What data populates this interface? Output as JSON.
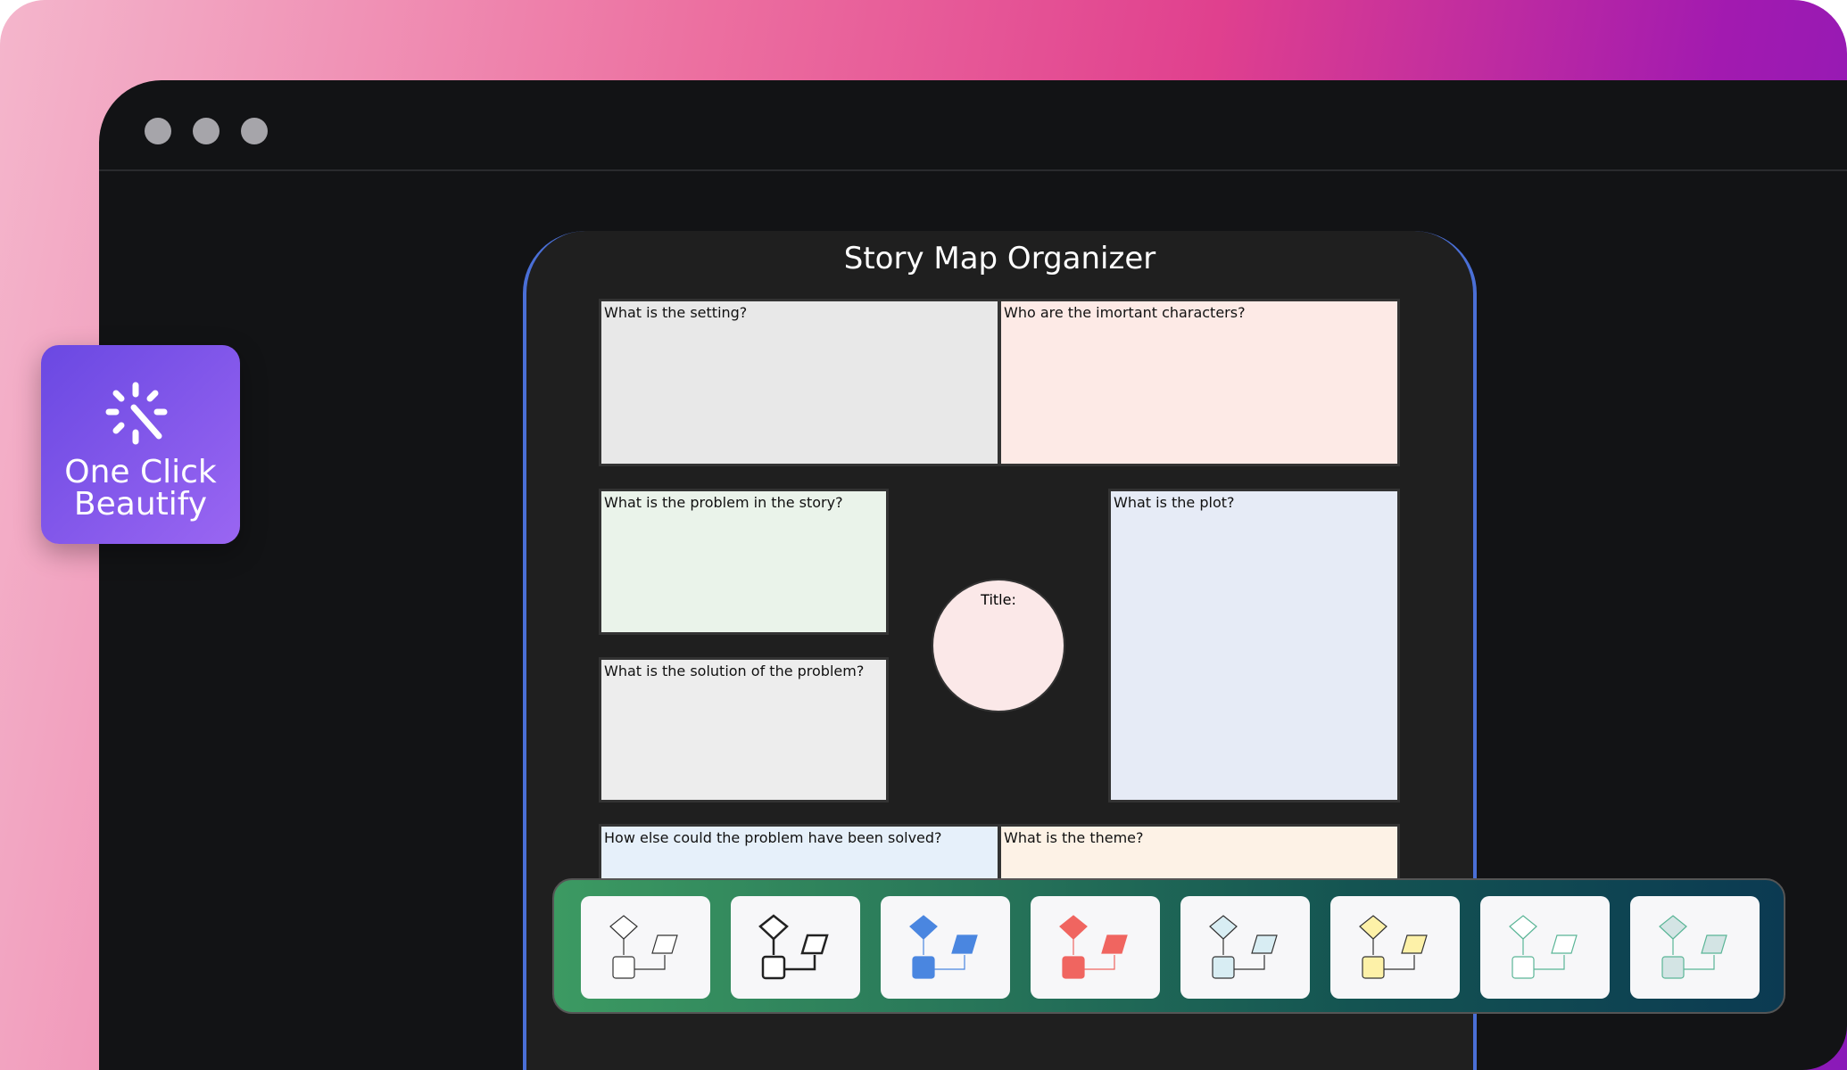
{
  "badge": {
    "label_line1": "One Click",
    "label_line2": "Beautify",
    "icon": "magic-wand-sparkle-icon"
  },
  "diagram": {
    "title": "Story Map Organizer",
    "boxes": [
      {
        "label": "What is the setting?",
        "color": "#e8e8e8"
      },
      {
        "label": "Who are the imortant characters?",
        "color": "#fdeae6"
      },
      {
        "label": "What is the problem in the story?",
        "color": "#eaf3ea"
      },
      {
        "label": "What is the plot?",
        "color": "#e6ebf6"
      },
      {
        "label": "What is the solution of the problem?",
        "color": "#ededed"
      },
      {
        "label": "How else could the problem have been solved?",
        "color": "#e6f0fa"
      },
      {
        "label": "What is the theme?",
        "color": "#fdf2e6"
      }
    ],
    "circle": {
      "label": "Title:",
      "color": "#fbe8e8"
    }
  },
  "themes": [
    {
      "name": "outline-thin",
      "stroke": "#333333",
      "fill": "#ffffff"
    },
    {
      "name": "outline-bold",
      "stroke": "#222222",
      "fill": "#ffffff"
    },
    {
      "name": "blue",
      "stroke": "#4a86e0",
      "fill": "#4a86e0"
    },
    {
      "name": "red",
      "stroke": "#f06560",
      "fill": "#f06560"
    },
    {
      "name": "light-blue",
      "stroke": "#333333",
      "fill": "#d8edf3"
    },
    {
      "name": "yellow",
      "stroke": "#333333",
      "fill": "#fdf1a8"
    },
    {
      "name": "green-outline",
      "stroke": "#5ab596",
      "fill": "#ffffff"
    },
    {
      "name": "muted-teal",
      "stroke": "#5ab596",
      "fill": "#d3e4e4"
    }
  ]
}
